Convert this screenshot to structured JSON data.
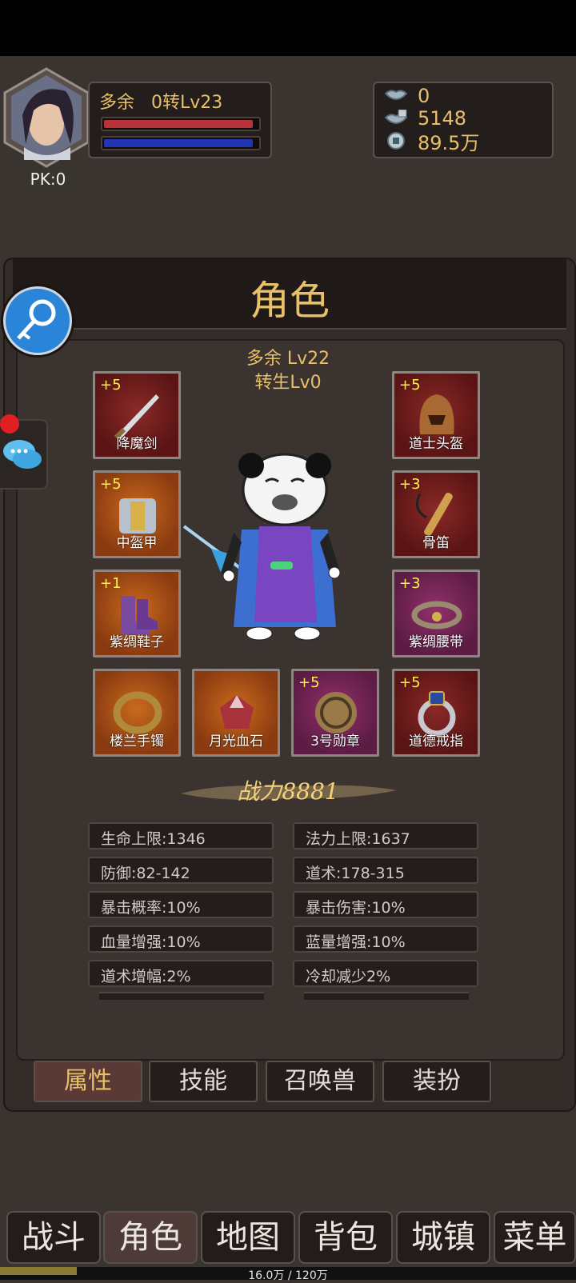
{
  "header": {
    "pk_text": "PK:0",
    "name": "多余",
    "level_text": "0转Lv23",
    "hp_fraction": 0.97,
    "mp_fraction": 0.97
  },
  "currencies": [
    {
      "icon": "ingot-icon",
      "value": "0"
    },
    {
      "icon": "locked-ingot-icon",
      "value": "5148"
    },
    {
      "icon": "coin-icon",
      "value": "89.5万"
    }
  ],
  "panel": {
    "title": "角色",
    "char_name": "多余 Lv22",
    "rebirth": "转生Lv0"
  },
  "equipment": [
    {
      "slot": "weapon",
      "name": "降魔剑",
      "plus": "+5",
      "rarity": "red",
      "icon": "sword-icon"
    },
    {
      "slot": "helmet",
      "name": "道士头盔",
      "plus": "+5",
      "rarity": "red",
      "icon": "helmet-icon"
    },
    {
      "slot": "armor",
      "name": "中盔甲",
      "plus": "+5",
      "rarity": "orange",
      "icon": "armor-icon"
    },
    {
      "slot": "necklace",
      "name": "骨笛",
      "plus": "+3",
      "rarity": "red",
      "icon": "flute-icon"
    },
    {
      "slot": "boots",
      "name": "紫绸鞋子",
      "plus": "+1",
      "rarity": "orange",
      "icon": "boots-icon"
    },
    {
      "slot": "belt",
      "name": "紫绸腰带",
      "plus": "+3",
      "rarity": "purple",
      "icon": "belt-icon"
    },
    {
      "slot": "bracelet",
      "name": "楼兰手镯",
      "plus": "",
      "rarity": "orange",
      "icon": "bracelet-icon"
    },
    {
      "slot": "gem",
      "name": "月光血石",
      "plus": "",
      "rarity": "orange",
      "icon": "gem-icon"
    },
    {
      "slot": "medal",
      "name": "3号勋章",
      "plus": "+5",
      "rarity": "purple",
      "icon": "medal-icon"
    },
    {
      "slot": "ring",
      "name": "道德戒指",
      "plus": "+5",
      "rarity": "red",
      "icon": "ring-icon"
    }
  ],
  "combat_power": "战力8881",
  "stats": [
    "生命上限:1346",
    "法力上限:1637",
    "防御:82-142",
    "道术:178-315",
    "暴击概率:10%",
    "暴击伤害:10%",
    "血量增强:10%",
    "蓝量增强:10%",
    "道术增幅:2%",
    "冷却减少2%"
  ],
  "sub_tabs": [
    "属性",
    "技能",
    "召唤兽",
    "装扮"
  ],
  "nav_tabs": [
    "战斗",
    "角色",
    "地图",
    "背包",
    "城镇",
    "菜单"
  ],
  "xp": {
    "text": "16.0万 / 120万",
    "fraction": 0.133
  },
  "colors": {
    "gold": "#e8c06a",
    "hp": "#b8323a",
    "mp": "#2034b4",
    "bg": "#3a3431"
  }
}
